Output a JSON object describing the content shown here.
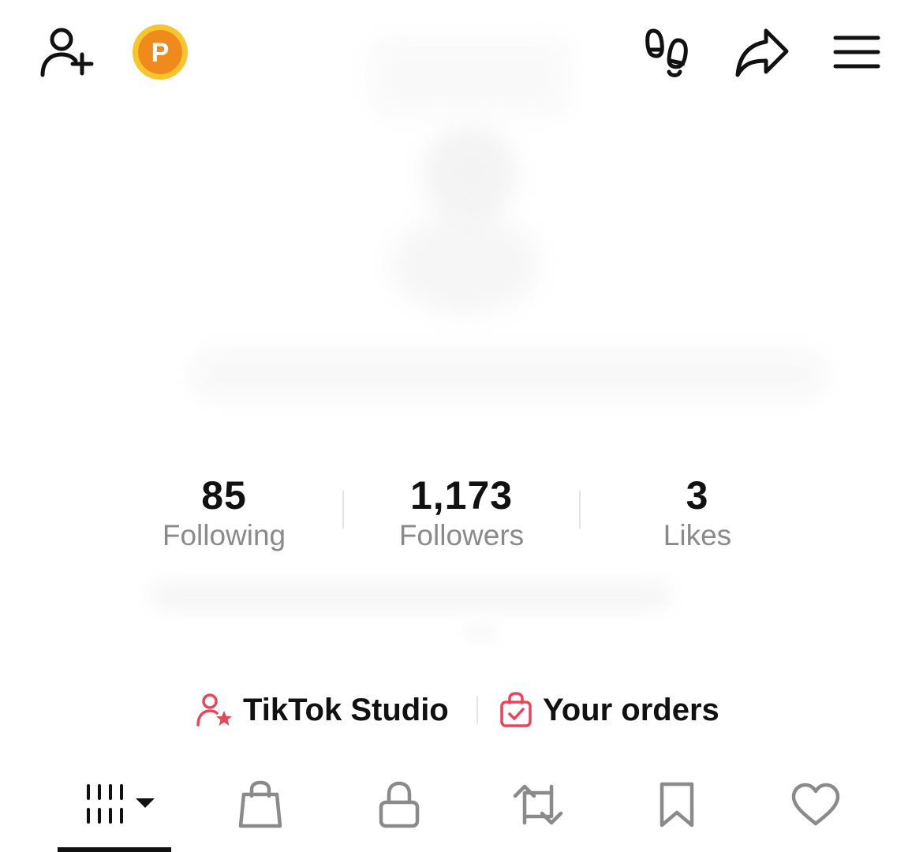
{
  "top_bar": {
    "add_friend_icon": "person-add-icon",
    "coin_icon": "p-coin-icon",
    "coin_letter": "P",
    "footprints_icon": "footprints-icon",
    "share_icon": "share-icon",
    "menu_icon": "hamburger-menu-icon"
  },
  "stats": [
    {
      "value": "85",
      "label": "Following"
    },
    {
      "value": "1,173",
      "label": "Followers"
    },
    {
      "value": "3",
      "label": "Likes"
    }
  ],
  "links": {
    "studio": {
      "label": "TikTok Studio",
      "icon": "person-star-icon"
    },
    "orders": {
      "label": "Your orders",
      "icon": "shopping-bag-check-icon"
    }
  },
  "tabs": [
    {
      "name": "videos",
      "icon": "grid-bars-icon",
      "active": true
    },
    {
      "name": "shop",
      "icon": "shopping-bag-icon",
      "active": false
    },
    {
      "name": "private",
      "icon": "lock-icon",
      "active": false
    },
    {
      "name": "reposts",
      "icon": "repost-icon",
      "active": false
    },
    {
      "name": "favorites",
      "icon": "bookmark-icon",
      "active": false
    },
    {
      "name": "liked",
      "icon": "heart-icon",
      "active": false
    }
  ],
  "colors": {
    "accent": "#e8445a",
    "coin_outer": "#f9c52c",
    "coin_inner": "#f08a1c",
    "text_primary": "#111111",
    "text_secondary": "#8a8a8a",
    "tab_icon_inactive": "#8a8a8a"
  }
}
